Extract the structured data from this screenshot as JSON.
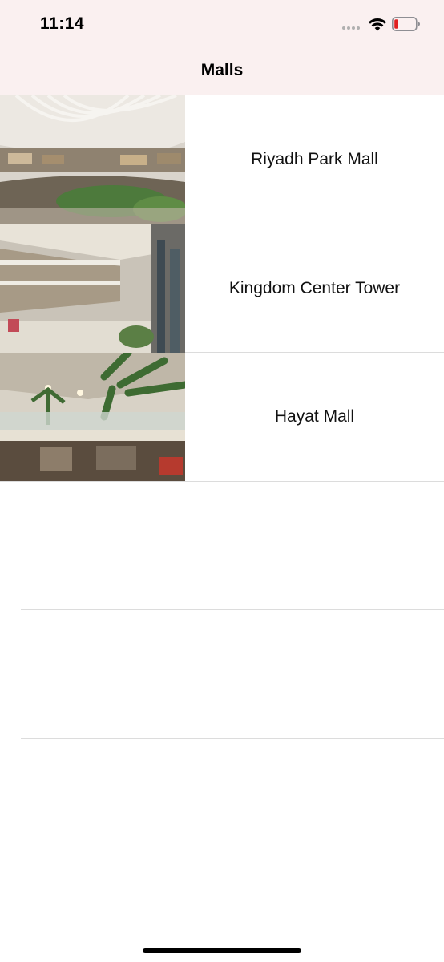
{
  "status_bar": {
    "time": "11:14",
    "wifi_icon": "wifi-icon",
    "battery_icon": "battery-low-icon",
    "battery_color": "#e02020"
  },
  "nav": {
    "title": "Malls"
  },
  "malls": [
    {
      "name": "Riyadh Park Mall",
      "image": "mall-interior-photo"
    },
    {
      "name": "Kingdom Center Tower",
      "image": "mall-interior-photo"
    },
    {
      "name": "Hayat Mall",
      "image": "mall-interior-photo"
    }
  ]
}
